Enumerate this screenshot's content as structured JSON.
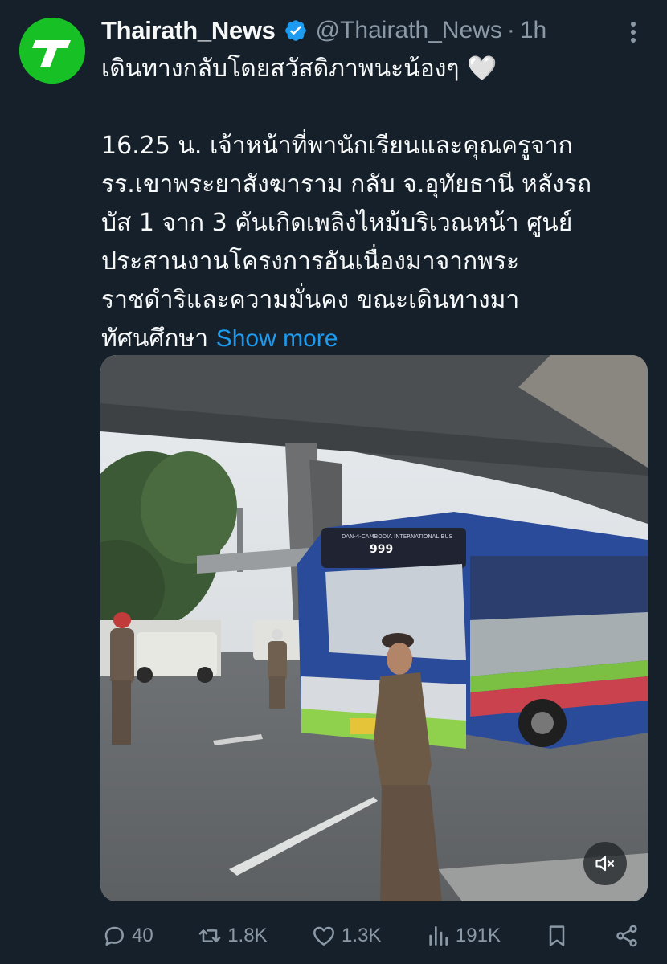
{
  "author": {
    "display_name": "Thairath_News",
    "handle": "@Thairath_News",
    "separator": "·",
    "time": "1h",
    "avatar_icon": "thairath-logo-icon",
    "verified_icon": "verified-badge-icon",
    "brand_color": "#17c125"
  },
  "post": {
    "line1": "เดินทางกลับโดยสวัสดิภาพนะน้องๆ 🤍",
    "body_lines": [
      "16.25 น. เจ้าหน้าที่พานักเรียนและคุณครูจาก",
      "รร.เขาพระยาสังฆาราม กลับ จ.อุทัยธานี หลังรถ",
      "บัส 1 จาก 3 คันเกิดเพลิงไหม้บริเวณหน้า ศูนย์",
      "ประสานงานโครงการอันเนื่องมาจากพระ",
      "ราชดำริและความมั่นคง ขณะเดินทางมา",
      "ทัศนศึกษา"
    ],
    "show_more": "Show more"
  },
  "media": {
    "bus_number": "999",
    "bus_banner": "DAN-4-CAMBODIA INTERNATIONAL BUS",
    "mute_icon": "speaker-muted-icon"
  },
  "actions": {
    "reply_count": "40",
    "repost_count": "1.8K",
    "like_count": "1.3K",
    "view_count": "191K",
    "reply_icon": "reply-icon",
    "repost_icon": "repost-icon",
    "like_icon": "heart-icon",
    "views_icon": "views-chart-icon",
    "bookmark_icon": "bookmark-icon",
    "share_icon": "share-icon"
  },
  "colors": {
    "background": "#15202b",
    "text": "#f7f9f9",
    "muted": "#8b98a5",
    "link": "#1d9bf0"
  }
}
